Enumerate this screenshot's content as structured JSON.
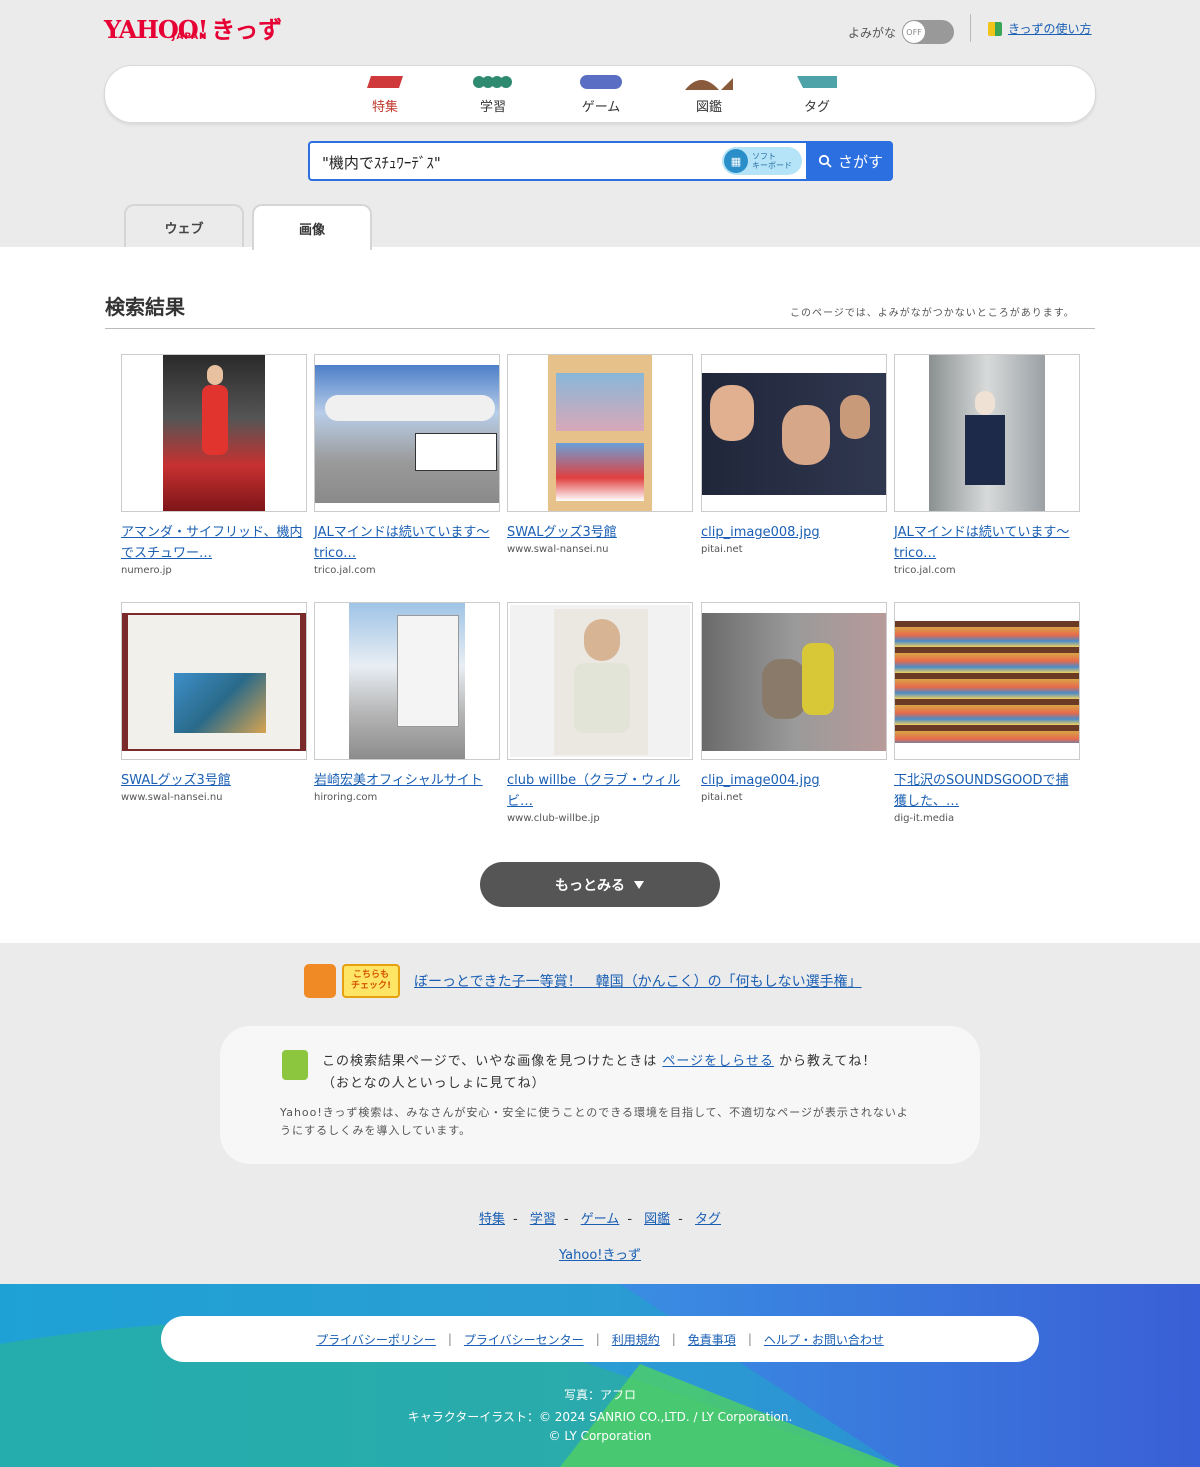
{
  "header": {
    "logo_main": "YAHOO!",
    "logo_sub": "JAPAN",
    "logo_kids": "きっず",
    "yomigana_label": "よみがな",
    "yomigana_state": "OFF",
    "howto_label": "きっずの使い方"
  },
  "nav": {
    "items": [
      {
        "label": "特集",
        "icon": "tokushu-icon",
        "color": "#d0393b"
      },
      {
        "label": "学習",
        "icon": "gakushu-icon",
        "color": "#2e8b6f"
      },
      {
        "label": "ゲーム",
        "icon": "game-icon",
        "color": "#5a6fc4"
      },
      {
        "label": "図鑑",
        "icon": "zukan-icon",
        "color": "#8a5a3c"
      },
      {
        "label": "タグ",
        "icon": "tag-icon",
        "color": "#4ea3a8"
      }
    ]
  },
  "search": {
    "query": "\"機内でｽﾁｭﾜｰﾃﾞｽ\"",
    "softkb_label_1": "ソフト",
    "softkb_label_2": "キーボード",
    "button_label": "さがす"
  },
  "tabs": [
    {
      "label": "ウェブ"
    },
    {
      "label": "画像"
    }
  ],
  "results": {
    "heading": "検索結果",
    "note": "このページでは、よみがながつかないところがあります。",
    "items": [
      {
        "title": "アマンダ・サイフリッド、機内でスチュワー…",
        "domain": "numero.jp"
      },
      {
        "title": "JALマインドは続いています〜trico…",
        "domain": "trico.jal.com"
      },
      {
        "title": "SWALグッズ3号館",
        "domain": "www.swal-nansei.nu"
      },
      {
        "title": "clip_image008.jpg",
        "domain": "pitai.net"
      },
      {
        "title": "JALマインドは続いています〜trico…",
        "domain": "trico.jal.com"
      },
      {
        "title": "SWALグッズ3号館",
        "domain": "www.swal-nansei.nu"
      },
      {
        "title": "岩崎宏美オフィシャルサイト",
        "domain": "hiroring.com"
      },
      {
        "title": "club willbe（クラブ・ウィルビ…",
        "domain": "www.club-willbe.jp"
      },
      {
        "title": "clip_image004.jpg",
        "domain": "pitai.net"
      },
      {
        "title": "下北沢のSOUNDSGOODで捕獲した、…",
        "domain": "dig-it.media"
      }
    ],
    "more_label": "もっとみる"
  },
  "check": {
    "badge_1": "こちらも",
    "badge_2": "チェック!",
    "link": "ぼーっとできた子一等賞！　韓国（かんこく）の「何もしない選手権」"
  },
  "report": {
    "line1_pre": "この検索結果ページで、いやな画像を見つけたときは",
    "line1_link": "ページをしらせる",
    "line1_post": "から教えてね！",
    "line2": "（おとなの人といっしょに見てね）",
    "small": "Yahoo!きっず検索は、みなさんが安心・安全に使うことのできる環境を目指して、不適切なページが表示されないようにするしくみを導入しています。"
  },
  "footer_nav": {
    "items": [
      "特集",
      "学習",
      "ゲーム",
      "図鑑",
      "タグ"
    ],
    "separator": "-",
    "home": "Yahoo!きっず"
  },
  "footer": {
    "links": [
      "プライバシーポリシー",
      "プライバシーセンター",
      "利用規約",
      "免責事項",
      "ヘルプ・お問い合わせ"
    ],
    "separator": "|",
    "photo_credit": "写真：アフロ",
    "illust_credit": "キャラクターイラスト：© 2024 SANRIO CO.,LTD. / LY Corporation.",
    "copyright": "© LY Corporation"
  }
}
